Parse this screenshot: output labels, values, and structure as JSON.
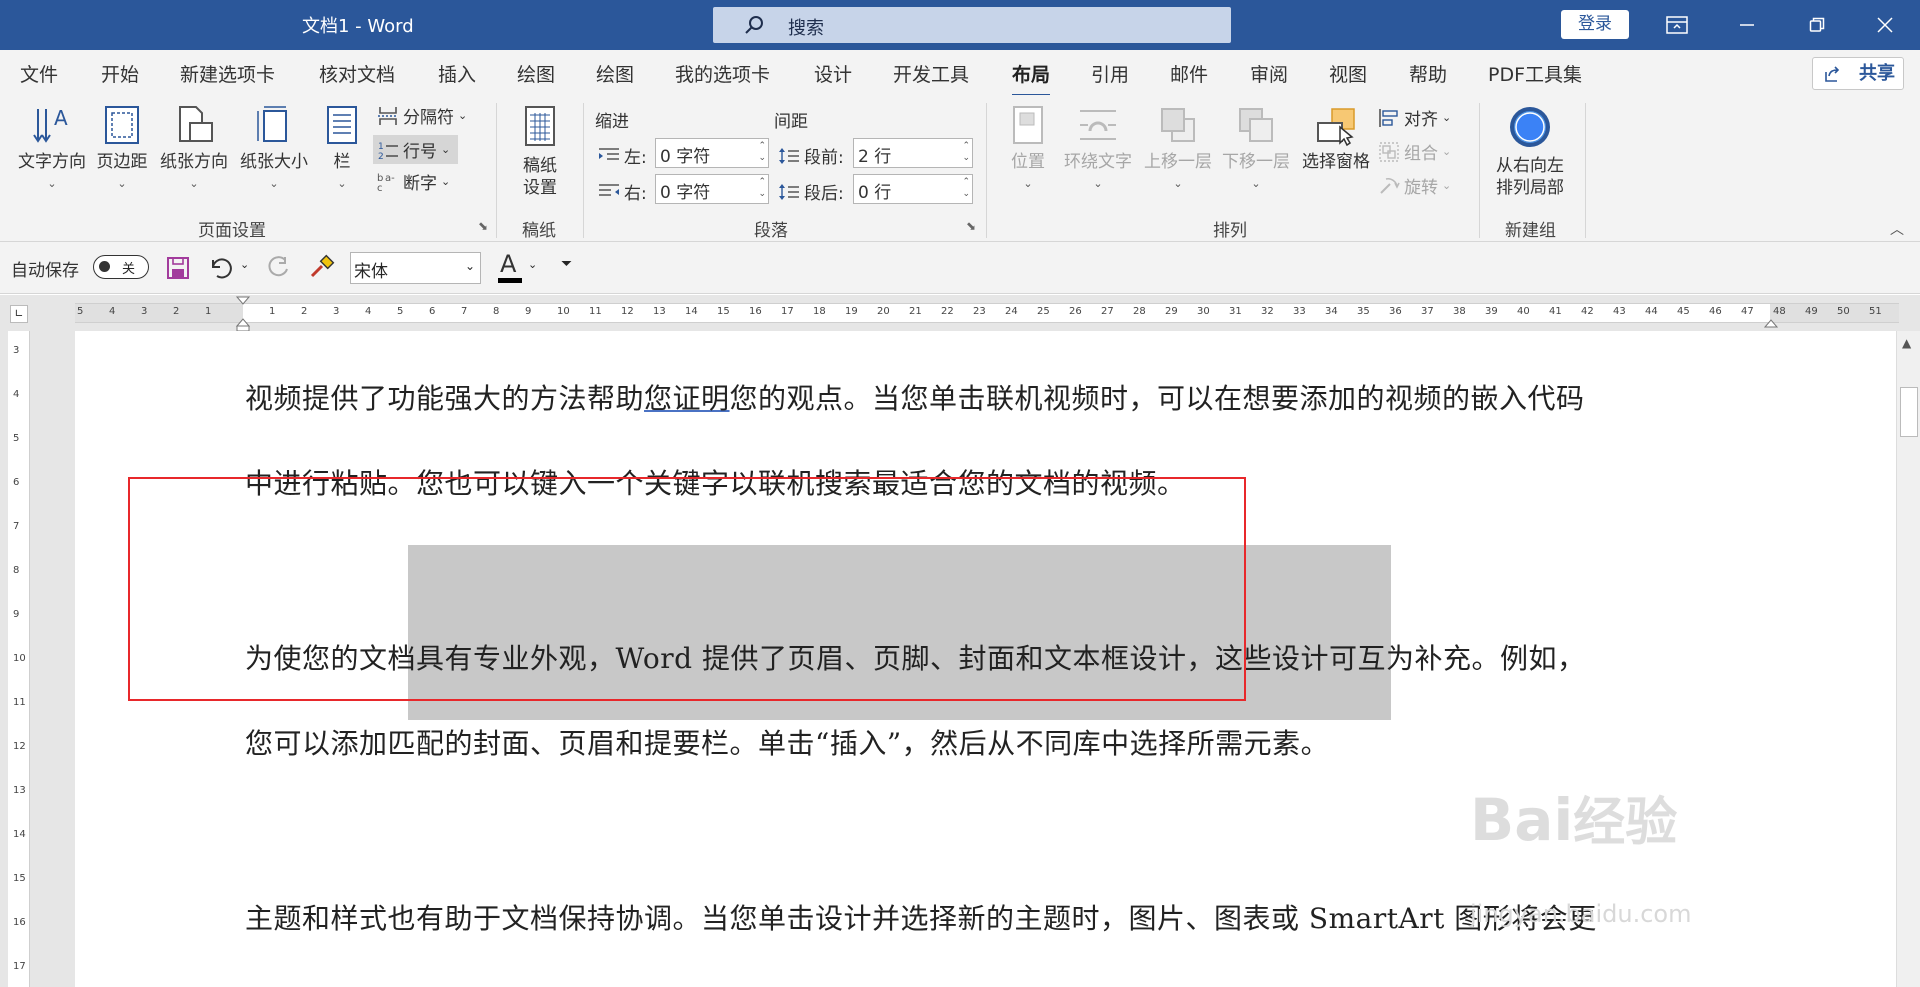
{
  "titlebar": {
    "title": "文档1  -  Word",
    "search_placeholder": "搜索",
    "login": "登录",
    "bg": "#2b579a"
  },
  "tabs": [
    "文件",
    "开始",
    "新建选项卡",
    "核对文档",
    "插入",
    "绘图",
    "绘图",
    "我的选项卡",
    "设计",
    "开发工具",
    "布局",
    "引用",
    "邮件",
    "审阅",
    "视图",
    "帮助",
    "PDF工具集"
  ],
  "active_tab": "布局",
  "share": "共享",
  "ribbon": {
    "page_setup": {
      "label": "页面设置",
      "text_direction": "文字方向",
      "margins": "页边距",
      "orientation": "纸张方向",
      "size": "纸张大小",
      "columns": "栏",
      "breaks": "分隔符",
      "line_numbers": "行号",
      "hyphenation": "断字"
    },
    "manuscript": {
      "label": "稿纸",
      "setup": "稿纸设置"
    },
    "paragraph": {
      "label": "段落",
      "indent": "缩进",
      "spacing": "间距",
      "left": "左:",
      "right": "右:",
      "before": "段前:",
      "after": "段后:",
      "left_val": "0 字符",
      "right_val": "0 字符",
      "before_val": "2 行",
      "after_val": "0 行"
    },
    "arrange": {
      "label": "排列",
      "position": "位置",
      "wrap": "环绕文字",
      "forward": "上移一层",
      "backward": "下移一层",
      "selection_pane": "选择窗格",
      "align": "对齐",
      "group": "组合",
      "rotate": "旋转"
    },
    "new_group": {
      "label": "新建组",
      "rtl": "从右向左排列局部"
    }
  },
  "qat": {
    "autosave": "自动保存",
    "autosave_state": "关",
    "font": "宋体",
    "font_color_letter": "A"
  },
  "ruler_numbers": [
    "5",
    "4",
    "3",
    "2",
    "1",
    "",
    "1",
    "2",
    "3",
    "4",
    "5",
    "6",
    "7",
    "8",
    "9",
    "10",
    "11",
    "12",
    "13",
    "14",
    "15",
    "16",
    "17",
    "18",
    "19",
    "20",
    "21",
    "22",
    "23",
    "24",
    "25",
    "26",
    "27",
    "28",
    "29",
    "30",
    "31",
    "32",
    "33",
    "34",
    "35",
    "36",
    "37",
    "38",
    "39",
    "40",
    "41",
    "42",
    "43",
    "44",
    "45",
    "46",
    "47",
    "48",
    "49",
    "50",
    "51"
  ],
  "vruler_numbers": [
    "3",
    "4",
    "5",
    "6",
    "7",
    "8",
    "9",
    "10",
    "11",
    "12",
    "13",
    "14",
    "15",
    "16",
    "17"
  ],
  "document": {
    "p1a_pre": "视频提供了功能强大的方法帮助",
    "p1a_ul": "您证明",
    "p1a_post": "您的观点。当您单击联机视频时，可以在想要添加的视频的嵌入代码",
    "p1b": "中进行粘贴。您也可以键入一个关键字以联机搜索最适合您的文档的视频。",
    "p2a": "为使您的文档具有专业外观，Word  提供了页眉、页脚、封面和文本框设计，这些设计可互为补充。例如，",
    "p2b": "您可以添加匹配的封面、页眉和提要栏。单击“插入”，然后从不同库中选择所需元素。",
    "p3a": "主题和样式也有助于文档保持协调。当您单击设计并选择新的主题时，图片、图表或 SmartArt 图形将会更"
  },
  "watermark": {
    "brand": "Bai",
    "suffix": "经验",
    "url": "jingyan.baidu.com"
  }
}
